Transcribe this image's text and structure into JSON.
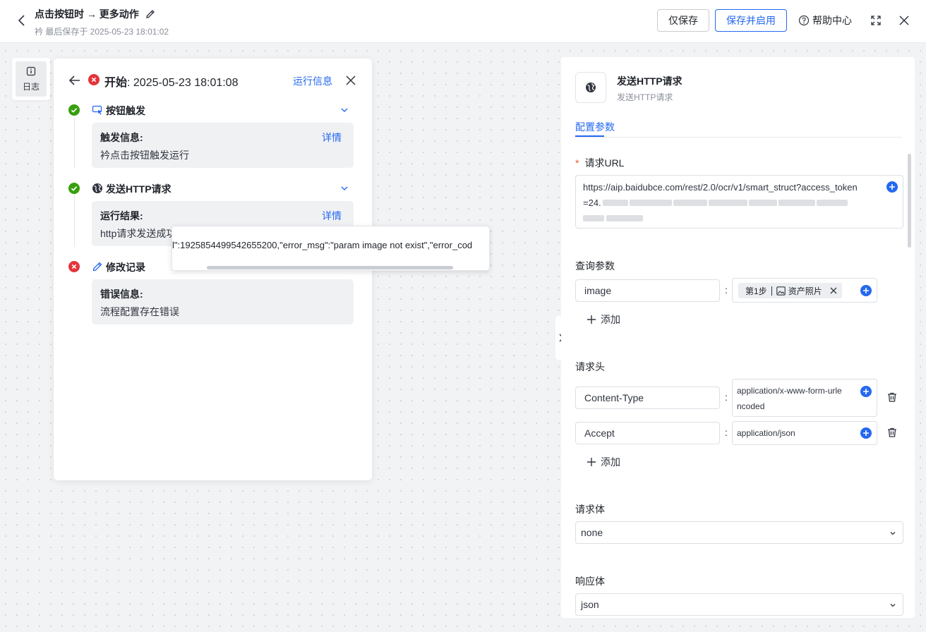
{
  "header": {
    "title": "点击按钮时 → 更多动作",
    "saved_text": "衿 最后保存于 2025-05-23 18:01:02",
    "save_only": "仅保存",
    "save_and_enable": "保存并启用",
    "help": "帮助中心"
  },
  "log_tab": {
    "label": "日志"
  },
  "log_panel": {
    "title_prefix": "开始",
    "title_time": ": 2025-05-23 18:01:08",
    "run_info": "运行信息",
    "steps": [
      {
        "title": "按钮触发",
        "status": "success",
        "icon": "pointer-icon",
        "card_label": "触发信息:",
        "detail": "详情",
        "card_value": "衿点击按钮触发运行"
      },
      {
        "title": "发送HTTP请求",
        "status": "success",
        "icon": "globe-icon",
        "card_label": "运行结果:",
        "detail": "详情",
        "card_value": "http请求发送成功"
      },
      {
        "title": "修改记录",
        "status": "error",
        "icon": "pencil-icon",
        "card_label": "错误信息:",
        "card_value": "流程配置存在错误"
      }
    ],
    "tooltip": "l\":1925854499542655200,\"error_msg\":\"param image not exist\",\"error_cod"
  },
  "config": {
    "title": "发送HTTP请求",
    "subtitle": "发送HTTP请求",
    "tab": "配置参数",
    "url_label": "请求URL",
    "url_value": "https://aip.baidubce.com/rest/2.0/ocr/v1/smart_struct?access_token",
    "url_line2_prefix": "=24.",
    "query_label": "查询参数",
    "query": {
      "key": "image",
      "chip_step": "第1步",
      "chip_name": "资产照片"
    },
    "add_label": "添加",
    "headers_label": "请求头",
    "headers": [
      {
        "key": "Content-Type",
        "value_line1": "application/x-www-form-urle",
        "value_line2": "ncoded"
      },
      {
        "key": "Accept",
        "value_line1": "application/json"
      }
    ],
    "body_label": "请求体",
    "body_value": "none",
    "response_label": "响应体",
    "response_value": "json"
  },
  "colors": {
    "accent": "#2468f2",
    "success": "#389e0d",
    "error": "#e5333a"
  }
}
